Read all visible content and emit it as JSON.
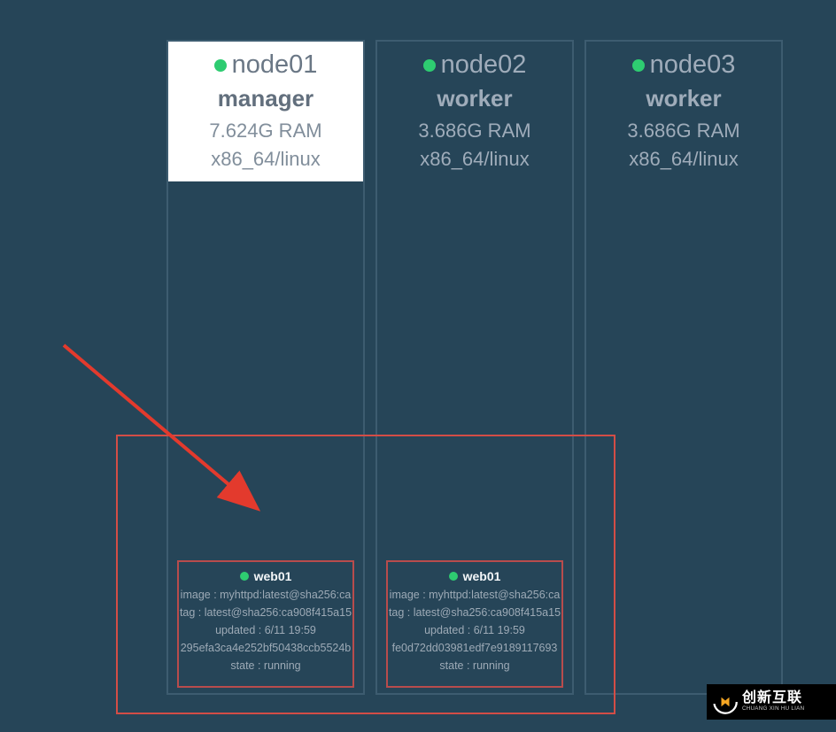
{
  "nodes": [
    {
      "name": "node01",
      "role": "manager",
      "ram": "7.624G RAM",
      "arch": "x86_64/linux",
      "active": true,
      "task": {
        "name": "web01",
        "image": "image : myhttpd:latest@sha256:ca",
        "tag": "tag : latest@sha256:ca908f415a15",
        "updated": "updated : 6/11 19:59",
        "id": "295efa3ca4e252bf50438ccb5524b",
        "state": "state : running"
      }
    },
    {
      "name": "node02",
      "role": "worker",
      "ram": "3.686G RAM",
      "arch": "x86_64/linux",
      "active": false,
      "task": {
        "name": "web01",
        "image": "image : myhttpd:latest@sha256:ca",
        "tag": "tag : latest@sha256:ca908f415a15",
        "updated": "updated : 6/11 19:59",
        "id": "fe0d72dd03981edf7e9189117693",
        "state": "state : running"
      }
    },
    {
      "name": "node03",
      "role": "worker",
      "ram": "3.686G RAM",
      "arch": "x86_64/linux",
      "active": false,
      "task": null
    }
  ],
  "brand": {
    "cn": "创新互联",
    "en": "CHUANG XIN HU LIAN"
  }
}
